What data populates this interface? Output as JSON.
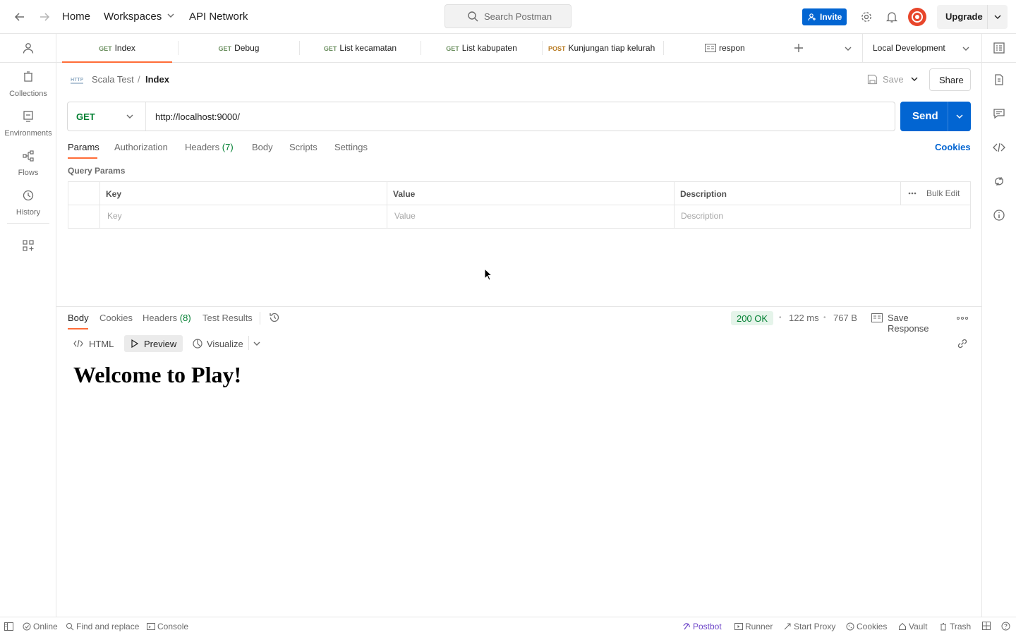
{
  "topbar": {
    "home": "Home",
    "workspaces": "Workspaces",
    "api_network": "API Network",
    "search_placeholder": "Search Postman",
    "invite": "Invite",
    "upgrade": "Upgrade"
  },
  "sidebar": {
    "items": [
      {
        "label": "Collections",
        "icon": "collections-icon"
      },
      {
        "label": "Environments",
        "icon": "environments-icon"
      },
      {
        "label": "Flows",
        "icon": "flows-icon"
      },
      {
        "label": "History",
        "icon": "history-icon"
      }
    ]
  },
  "tabs": [
    {
      "method": "GET",
      "name": "Index",
      "active": true
    },
    {
      "method": "GET",
      "name": "Debug"
    },
    {
      "method": "GET",
      "name": "List kecamatan"
    },
    {
      "method": "GET",
      "name": "List kabupaten"
    },
    {
      "method": "POST",
      "name": "Kunjungan tiap kelurah"
    },
    {
      "method": "",
      "name": "respon"
    }
  ],
  "environment": "Local Development",
  "breadcrumb": {
    "collection": "Scala Test",
    "separator": "/",
    "request": "Index"
  },
  "request_actions": {
    "save": "Save",
    "share": "Share"
  },
  "request": {
    "method": "GET",
    "url": "http://localhost:9000/",
    "send": "Send"
  },
  "request_tabs": {
    "params": "Params",
    "authorization": "Authorization",
    "headers": "Headers",
    "headers_count": "(7)",
    "body": "Body",
    "scripts": "Scripts",
    "settings": "Settings",
    "cookies": "Cookies"
  },
  "query_params": {
    "title": "Query Params",
    "columns": {
      "key": "Key",
      "value": "Value",
      "description": "Description"
    },
    "bulk_edit": "Bulk Edit",
    "placeholders": {
      "key": "Key",
      "value": "Value",
      "description": "Description"
    }
  },
  "response": {
    "tabs": {
      "body": "Body",
      "cookies": "Cookies",
      "headers": "Headers",
      "headers_count": "(8)",
      "test_results": "Test Results"
    },
    "status": "200 OK",
    "time": "122 ms",
    "size": "767 B",
    "save_response": "Save Response",
    "view_modes": {
      "html": "HTML",
      "preview": "Preview",
      "visualize": "Visualize"
    },
    "preview_heading": "Welcome to Play!"
  },
  "statusbar": {
    "online": "Online",
    "find_replace": "Find and replace",
    "console": "Console",
    "postbot": "Postbot",
    "runner": "Runner",
    "start_proxy": "Start Proxy",
    "cookies": "Cookies",
    "vault": "Vault",
    "trash": "Trash"
  },
  "colors": {
    "accent_orange": "#ff6c37",
    "send_blue": "#0265d2",
    "status_green": "#007f31",
    "postbot_purple": "#6e46c8"
  }
}
